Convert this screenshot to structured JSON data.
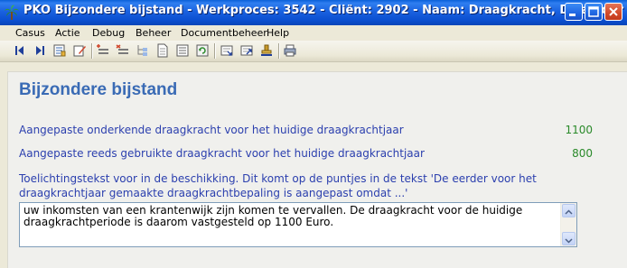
{
  "window": {
    "title": "PKO Bijzondere bijstand - Werkproces: 3542 - Cliënt: 2902 - Naam: Draagkracht, D van der",
    "controls": [
      "minimize",
      "maximize",
      "close"
    ]
  },
  "menu": {
    "items": [
      "Casus",
      "Actie",
      "Debug",
      "Beheer",
      "Documentbeheer",
      "Help"
    ]
  },
  "toolbar": {
    "icons": [
      "first-record-icon",
      "last-record-icon",
      "notes-icon",
      "edit-icon",
      "add-row-icon",
      "delete-row-icon",
      "tree-icon",
      "document-icon",
      "list-icon",
      "refresh-icon",
      "import-icon",
      "export-icon",
      "stamp-icon",
      "print-icon"
    ]
  },
  "main": {
    "heading": "Bijzondere bijstand",
    "fields": [
      {
        "label": "Aangepaste onderkende draagkracht voor het huidige draagkrachtjaar",
        "value": "1100"
      },
      {
        "label": "Aangepaste reeds gebruikte draagkracht voor het huidige draagkrachtjaar",
        "value": "800"
      }
    ],
    "note": "Toelichtingstekst voor in de beschikking. Dit komt op de puntjes in de tekst 'De eerder voor het draagkrachtjaar gemaakte draagkrachtbepaling is aangepast omdat ...'",
    "textarea_value": "uw inkomsten van een krantenwijk zijn komen te vervallen. De draagkracht voor de huidige draagkrachtperiode is daarom vastgesteld op 1100 Euro."
  },
  "colors": {
    "titlebar": "#0b4fd0",
    "heading": "#3a6bb5",
    "label": "#2b3fae",
    "value": "#2a8a2a"
  }
}
